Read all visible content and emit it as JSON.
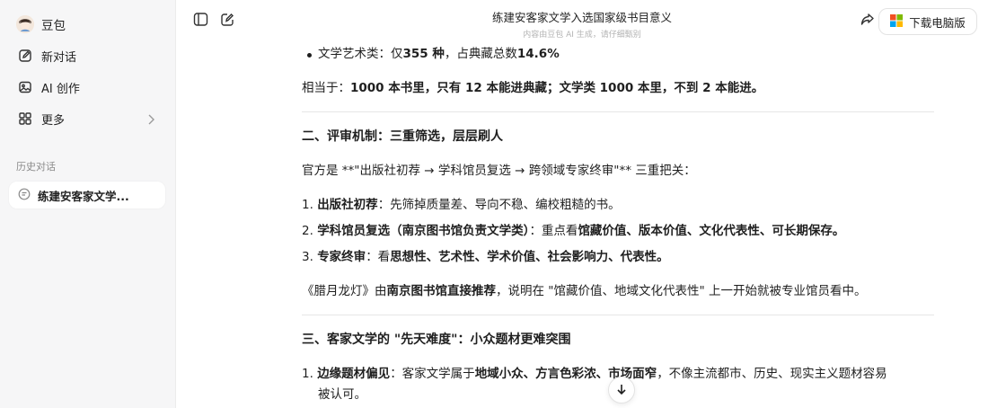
{
  "sidebar": {
    "brand": "豆包",
    "nav": [
      {
        "label": "新对话",
        "icon": "new-chat-icon"
      },
      {
        "label": "AI 创作",
        "icon": "image-icon"
      },
      {
        "label": "更多",
        "icon": "grid-icon"
      }
    ],
    "history_label": "历史对话",
    "history_items": [
      {
        "label": "练建安客家文学...",
        "icon": "chat-bubble-icon"
      }
    ]
  },
  "header": {
    "title": "练建安客家文学入选国家级书目意义",
    "subtitle": "内容由豆包 AI 生成，请仔细甄别",
    "download_label": "下载电脑版"
  },
  "content": {
    "p1": {
      "pre": "文学艺术类：仅",
      "b1": "355 种",
      "mid": "，占典藏总数",
      "b2": "14.6%"
    },
    "p2": {
      "pre": "相当于：",
      "b": "1000 本书里，只有 12 本能进典藏；文学类 1000 本里，不到 2 本能进。"
    },
    "h2": "二、评审机制：三重筛选，层层刷人",
    "p3": "官方是 **\"出版社初荐 → 学科馆员复选 → 跨领域专家终审\"** 三重把关：",
    "list1": [
      {
        "num": "1.",
        "b": "出版社初荐",
        "rest": "：先筛掉质量差、导向不稳、编校粗糙的书。"
      },
      {
        "num": "2.",
        "b": "学科馆员复选（南京图书馆负责文学类）",
        "mid": "：重点看",
        "b2": "馆藏价值、版本价值、文化代表性、可长期保存。"
      },
      {
        "num": "3.",
        "b": "专家终审",
        "rest": "：看",
        "b2": "思想性、艺术性、学术价值、社会影响力、代表性。"
      }
    ],
    "p4": {
      "pre": "《腊月龙灯》由",
      "b": "南京图书馆直接推荐",
      "rest": "，说明在 \"馆藏价值、地域文化代表性\" 上一开始就被专业馆员看中。"
    },
    "h3": "三、客家文学的 \"先天难度\"：小众题材更难突围",
    "list2": [
      {
        "num": "1.",
        "b": "边缘题材偏见",
        "mid": "：客家文学属于",
        "b2": "地域小众、方言色彩浓、市场面窄",
        "rest": "，不像主流都市、历史、现实主义题材容易",
        "cont": "被认可。"
      }
    ]
  }
}
